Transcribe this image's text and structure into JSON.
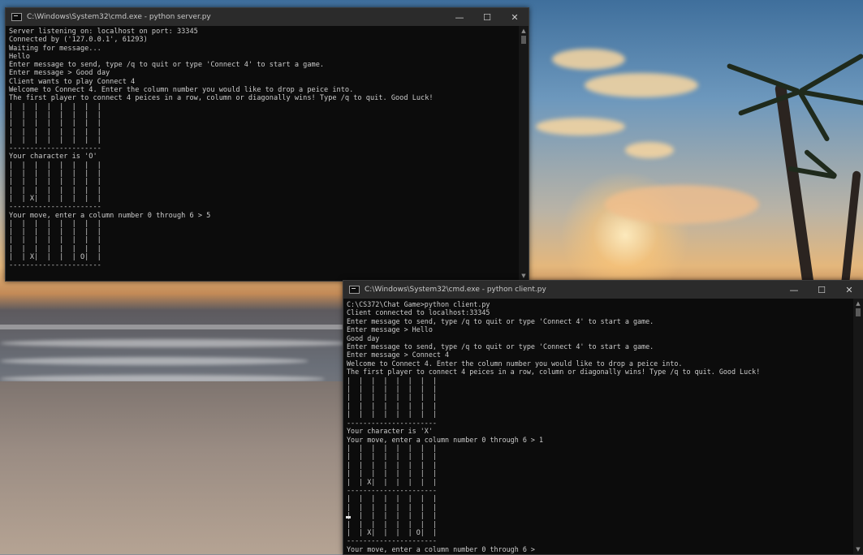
{
  "server_window": {
    "title": "C:\\Windows\\System32\\cmd.exe - python  server.py",
    "controls": {
      "minimize": "—",
      "maximize": "☐",
      "close": "✕"
    },
    "lines": [
      "Server listening on: localhost on port: 33345",
      "Connected by ('127.0.0.1', 61293)",
      "Waiting for message...",
      "Hello",
      "Enter message to send, type /q to quit or type 'Connect 4' to start a game.",
      "Enter message > Good day",
      "Client wants to play Connect 4",
      "Welcome to Connect 4. Enter the column number you would like to drop a peice into.",
      "The first player to connect 4 peices in a row, column or diagonally wins! Type /q to quit. Good Luck!",
      "|  |  |  |  |  |  |  |",
      "|  |  |  |  |  |  |  |",
      "|  |  |  |  |  |  |  |",
      "|  |  |  |  |  |  |  |",
      "|  |  |  |  |  |  |  |",
      "----------------------",
      "Your character is 'O'",
      "|  |  |  |  |  |  |  |",
      "|  |  |  |  |  |  |  |",
      "|  |  |  |  |  |  |  |",
      "|  |  |  |  |  |  |  |",
      "|  | X|  |  |  |  |  |",
      "----------------------",
      "Your move, enter a column number 0 through 6 > 5",
      "|  |  |  |  |  |  |  |",
      "|  |  |  |  |  |  |  |",
      "|  |  |  |  |  |  |  |",
      "|  |  |  |  |  |  |  |",
      "|  | X|  |  |  | O|  |",
      "----------------------"
    ]
  },
  "client_window": {
    "title": "C:\\Windows\\System32\\cmd.exe - python  client.py",
    "controls": {
      "minimize": "—",
      "maximize": "☐",
      "close": "✕"
    },
    "lines": [
      "C:\\CS372\\Chat Game>python client.py",
      "Client connected to localhost:33345",
      "Enter message to send, type /q to quit or type 'Connect 4' to start a game.",
      "Enter message > Hello",
      "Good day",
      "Enter message to send, type /q to quit or type 'Connect 4' to start a game.",
      "Enter message > Connect 4",
      "Welcome to Connect 4. Enter the column number you would like to drop a peice into.",
      "The first player to connect 4 peices in a row, column or diagonally wins! Type /q to quit. Good Luck!",
      "|  |  |  |  |  |  |  |",
      "|  |  |  |  |  |  |  |",
      "|  |  |  |  |  |  |  |",
      "|  |  |  |  |  |  |  |",
      "|  |  |  |  |  |  |  |",
      "----------------------",
      "Your character is 'X'",
      "Your move, enter a column number 0 through 6 > 1",
      "|  |  |  |  |  |  |  |",
      "|  |  |  |  |  |  |  |",
      "|  |  |  |  |  |  |  |",
      "|  |  |  |  |  |  |  |",
      "|  | X|  |  |  |  |  |",
      "----------------------",
      "|  |  |  |  |  |  |  |",
      "|  |  |  |  |  |  |  |",
      "|  |  |  |  |  |  |  |",
      "|  |  |  |  |  |  |  |",
      "|  | X|  |  |  | O|  |",
      "----------------------",
      "Your move, enter a column number 0 through 6 >"
    ]
  },
  "colors": {
    "console_bg": "#0c0c0c",
    "console_text": "#cccccc",
    "titlebar": "#2b2b2b"
  }
}
